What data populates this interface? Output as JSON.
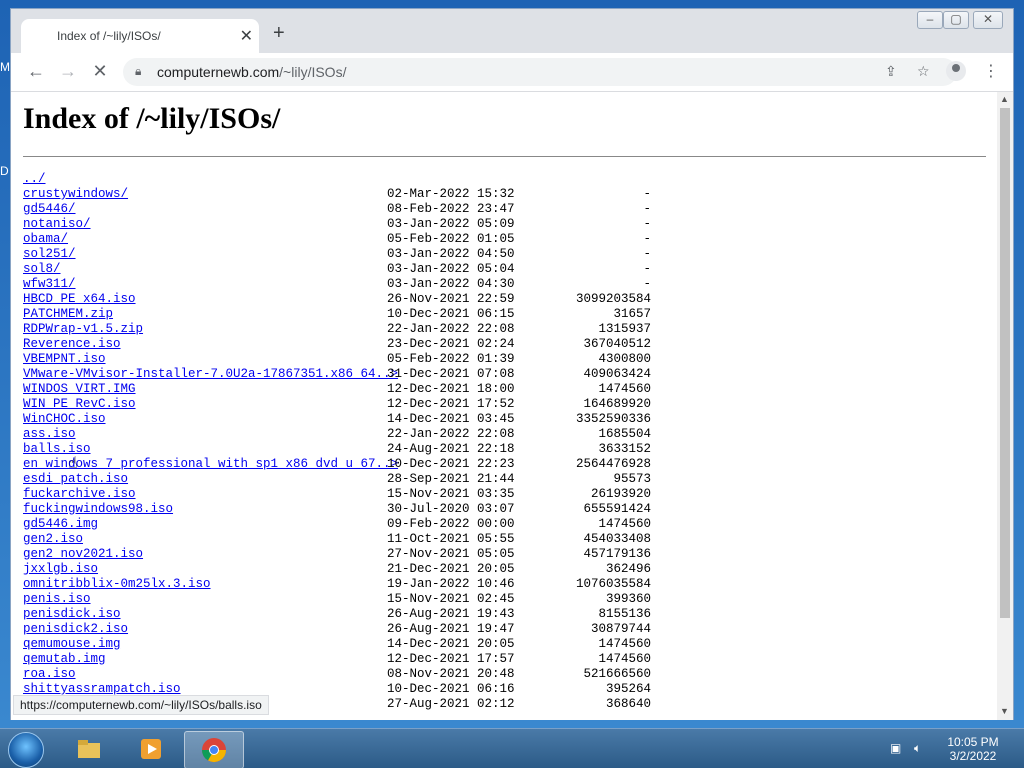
{
  "desktop": {
    "side_letters": [
      "M",
      "D"
    ]
  },
  "browser": {
    "tab_title": "Index of /~lily/ISOs/",
    "url_host": "computernewb.com",
    "url_path": "/~lily/ISOs/",
    "status_url": "https://computernewb.com/~lily/ISOs/balls.iso"
  },
  "page": {
    "heading": "Index of /~lily/ISOs/",
    "entries": [
      {
        "name": "../",
        "date": "",
        "size": ""
      },
      {
        "name": "crustywindows/",
        "date": "02-Mar-2022 15:32",
        "size": "-"
      },
      {
        "name": "gd5446/",
        "date": "08-Feb-2022 23:47",
        "size": "-"
      },
      {
        "name": "notaniso/",
        "date": "03-Jan-2022 05:09",
        "size": "-"
      },
      {
        "name": "obama/",
        "date": "05-Feb-2022 01:05",
        "size": "-"
      },
      {
        "name": "sol251/",
        "date": "03-Jan-2022 04:50",
        "size": "-"
      },
      {
        "name": "sol8/",
        "date": "03-Jan-2022 05:04",
        "size": "-"
      },
      {
        "name": "wfw311/",
        "date": "03-Jan-2022 04:30",
        "size": "-"
      },
      {
        "name": "HBCD_PE_x64.iso",
        "date": "26-Nov-2021 22:59",
        "size": "3099203584"
      },
      {
        "name": "PATCHMEM.zip",
        "date": "10-Dec-2021 06:15",
        "size": "31657"
      },
      {
        "name": "RDPWrap-v1.5.zip",
        "date": "22-Jan-2022 22:08",
        "size": "1315937"
      },
      {
        "name": "Reverence.iso",
        "date": "23-Dec-2021 02:24",
        "size": "367040512"
      },
      {
        "name": "VBEMPNT.iso",
        "date": "05-Feb-2022 01:39",
        "size": "4300800"
      },
      {
        "name": "VMware-VMvisor-Installer-7.0U2a-17867351.x86_64..>",
        "date": "31-Dec-2021 07:08",
        "size": "409063424"
      },
      {
        "name": "WINDOS_VIRT.IMG",
        "date": "12-Dec-2021 18:00",
        "size": "1474560"
      },
      {
        "name": "WIN_PE_RevC.iso",
        "date": "12-Dec-2021 17:52",
        "size": "164689920"
      },
      {
        "name": "WinCHOC.iso",
        "date": "14-Dec-2021 03:45",
        "size": "3352590336"
      },
      {
        "name": "ass.iso",
        "date": "22-Jan-2022 22:08",
        "size": "1685504"
      },
      {
        "name": "balls.iso",
        "date": "24-Aug-2021 22:18",
        "size": "3633152"
      },
      {
        "name": "en_windows_7_professional_with_sp1_x86_dvd_u_67..>",
        "date": "10-Dec-2021 22:23",
        "size": "2564476928"
      },
      {
        "name": "esdi_patch.iso",
        "date": "28-Sep-2021 21:44",
        "size": "95573"
      },
      {
        "name": "fuckarchive.iso",
        "date": "15-Nov-2021 03:35",
        "size": "26193920"
      },
      {
        "name": "fuckingwindows98.iso",
        "date": "30-Jul-2020 03:07",
        "size": "655591424"
      },
      {
        "name": "gd5446.img",
        "date": "09-Feb-2022 00:00",
        "size": "1474560"
      },
      {
        "name": "gen2.iso",
        "date": "11-Oct-2021 05:55",
        "size": "454033408"
      },
      {
        "name": "gen2_nov2021.iso",
        "date": "27-Nov-2021 05:05",
        "size": "457179136"
      },
      {
        "name": "jxxlgb.iso",
        "date": "21-Dec-2021 20:05",
        "size": "362496"
      },
      {
        "name": "omnitribblix-0m25lx.3.iso",
        "date": "19-Jan-2022 10:46",
        "size": "1076035584"
      },
      {
        "name": "penis.iso",
        "date": "15-Nov-2021 02:45",
        "size": "399360"
      },
      {
        "name": "penisdick.iso",
        "date": "26-Aug-2021 19:43",
        "size": "8155136"
      },
      {
        "name": "penisdick2.iso",
        "date": "26-Aug-2021 19:47",
        "size": "30879744"
      },
      {
        "name": "qemumouse.img",
        "date": "14-Dec-2021 20:05",
        "size": "1474560"
      },
      {
        "name": "qemutab.img",
        "date": "12-Dec-2021 17:57",
        "size": "1474560"
      },
      {
        "name": "roa.iso",
        "date": "08-Nov-2021 20:48",
        "size": "521666560"
      },
      {
        "name": "shittyassrampatch.iso",
        "date": "10-Dec-2021 06:16",
        "size": "395264"
      },
      {
        "name": "",
        "date": "27-Aug-2021 02:12",
        "size": "368640"
      }
    ]
  },
  "taskbar": {
    "time": "10:05 PM",
    "date": "3/2/2022"
  }
}
